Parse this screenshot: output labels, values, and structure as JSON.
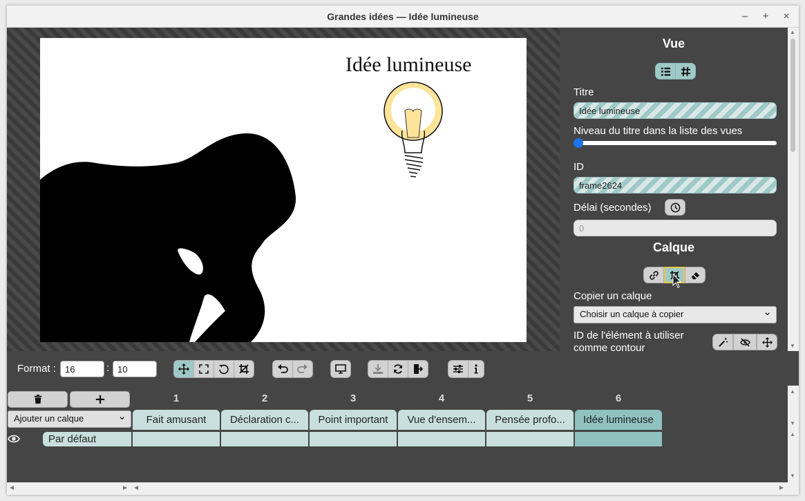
{
  "window": {
    "title": "Grandes idées — Idée lumineuse",
    "minimize": "–",
    "maximize": "+",
    "close": "×"
  },
  "slide": {
    "title": "Idée lumineuse"
  },
  "panel": {
    "view_heading": "Vue",
    "title_label": "Titre",
    "title_value": "Idée lumineuse",
    "level_label": "Niveau du titre dans la liste des vues",
    "id_label": "ID",
    "id_value": "frame2624",
    "delay_label": "Délai (secondes)",
    "delay_value": "0",
    "layer_heading": "Calque",
    "copy_label": "Copier un calque",
    "copy_select": "Choisir un calque à copier",
    "outline_label_1": "ID de l'élément à utiliser",
    "outline_label_2": "comme contour"
  },
  "toolbar": {
    "format_label": "Format :",
    "format_w": "16",
    "format_sep": ":",
    "format_h": "10"
  },
  "timeline": {
    "add_layer_select": "Ajouter un calque",
    "columns": [
      "1",
      "2",
      "3",
      "4",
      "5",
      "6"
    ],
    "frames": [
      "Fait amusant",
      "Déclaration c...",
      "Point important",
      "Vue d'ensem...",
      "Pensée profo...",
      "Idée lumineuse"
    ],
    "selected_frame": 6,
    "layer_name": "Par défaut"
  },
  "icons": [
    "list-icon",
    "hash-icon",
    "clock-icon",
    "link-icon",
    "crop-icon",
    "eraser-icon",
    "magic-wand-icon",
    "eye-off-icon",
    "move-icon",
    "trash-icon",
    "plus-icon",
    "undo-icon",
    "redo-icon",
    "monitor-icon",
    "download-icon",
    "refresh-icon",
    "export-icon",
    "sliders-icon",
    "info-icon",
    "eye-icon",
    "cursor-icon"
  ],
  "colors": {
    "accent": "#8fc2bf",
    "accent_light": "#c8dfdd",
    "panel": "#454545",
    "slider": "#1a73e8"
  }
}
